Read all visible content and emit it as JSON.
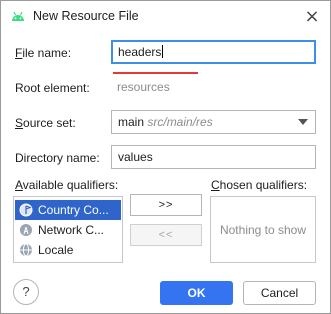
{
  "window": {
    "title": "New Resource File",
    "close_glyph": "×"
  },
  "form": {
    "file_name": {
      "label_key": "F",
      "label_rest": "ile name:",
      "value": "headers"
    },
    "root_element": {
      "label": "Root element:",
      "placeholder": "resources"
    },
    "source_set": {
      "label_key": "S",
      "label_rest": "ource set:",
      "value": "main",
      "path": "src/main/res"
    },
    "directory_name": {
      "label": "Directory name:",
      "value": "values"
    }
  },
  "qualifiers": {
    "available_label_key": "A",
    "available_label_rest": "vailable qualifiers:",
    "chosen_label_key": "C",
    "chosen_label_rest": "hosen qualifiers:",
    "available_items": [
      {
        "label": "Country Co...",
        "icon": "globe-flag-icon",
        "selected": true
      },
      {
        "label": "Network C...",
        "icon": "network-tower-icon",
        "selected": false
      },
      {
        "label": "Locale",
        "icon": "globe-icon",
        "selected": false
      }
    ],
    "add_button": ">>",
    "remove_button": "<<",
    "chosen_empty": "Nothing to show"
  },
  "footer": {
    "help": "?",
    "ok": "OK",
    "cancel": "Cancel"
  },
  "colors": {
    "accent": "#3574f0",
    "selection": "#2f65ca",
    "error": "#e53935",
    "android_green": "#3ddc84"
  }
}
